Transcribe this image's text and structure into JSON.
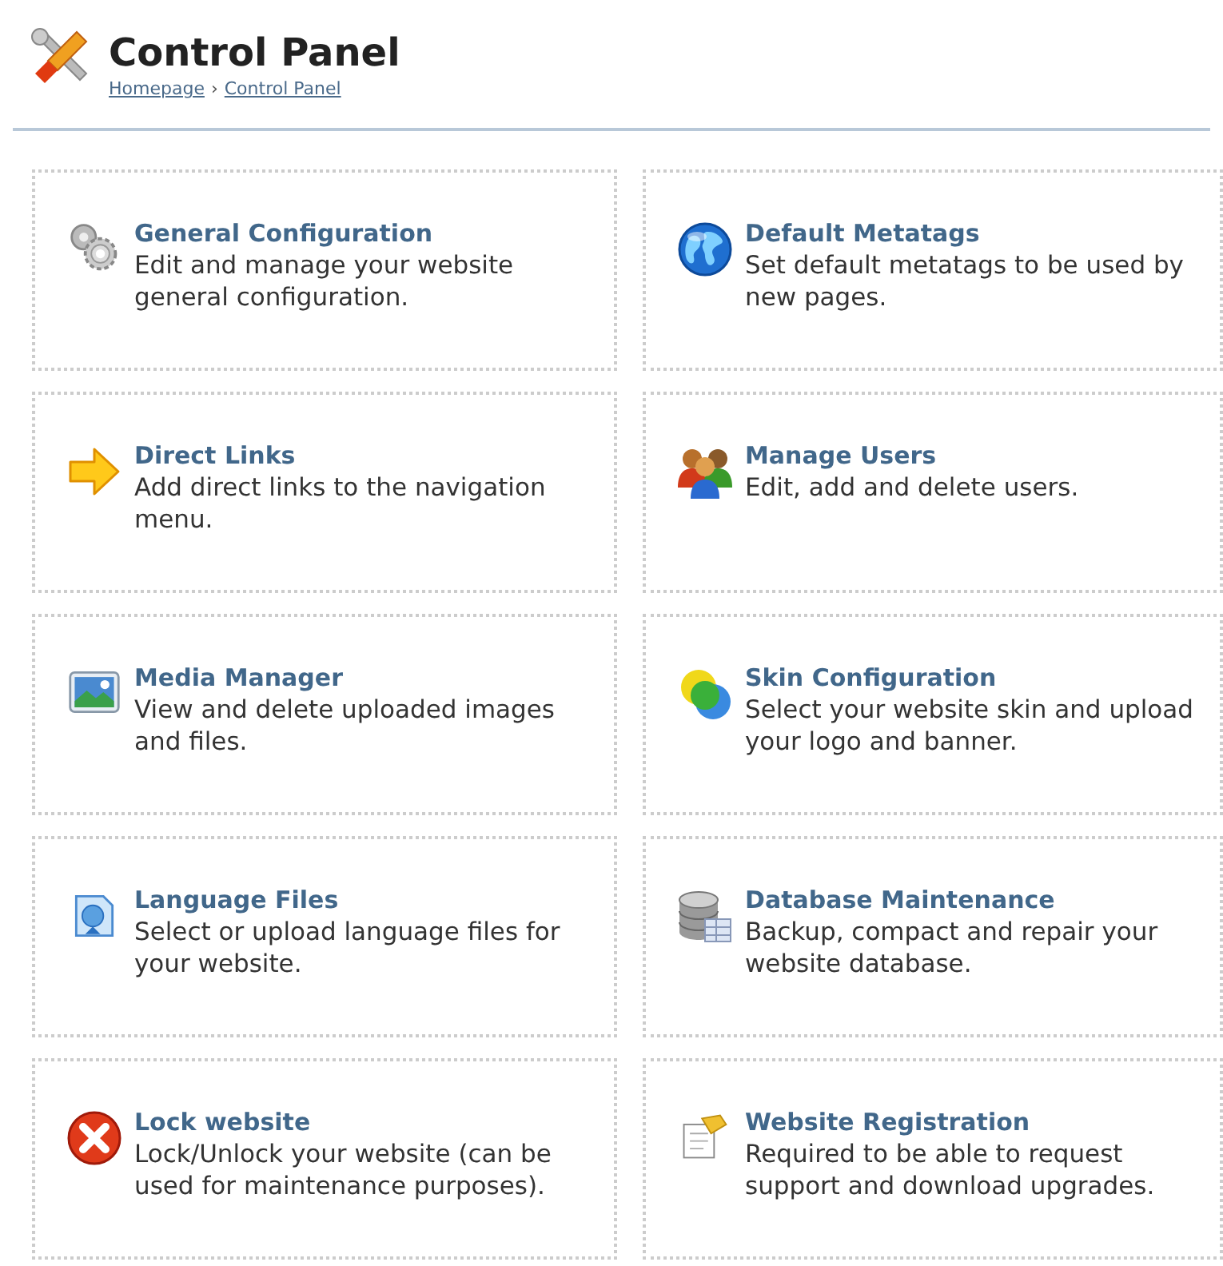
{
  "header": {
    "title": "Control Panel",
    "breadcrumb": [
      {
        "label": "Homepage"
      },
      {
        "label": "Control Panel"
      }
    ],
    "separator": "›"
  },
  "items": [
    {
      "title": "General Configuration",
      "description": "Edit and manage your website general configuration."
    },
    {
      "title": "Default Metatags",
      "description": "Set default metatags to be used by new pages."
    },
    {
      "title": "Direct Links",
      "description": "Add direct links to the navigation menu."
    },
    {
      "title": "Manage Users",
      "description": "Edit, add and delete users."
    },
    {
      "title": "Media Manager",
      "description": "View and delete uploaded images and files."
    },
    {
      "title": "Skin Configuration",
      "description": "Select your website skin and upload your logo and banner."
    },
    {
      "title": "Language Files",
      "description": "Select or upload language files for your website."
    },
    {
      "title": "Database Maintenance",
      "description": "Backup, compact and repair your website database."
    },
    {
      "title": "Lock website",
      "description": "Lock/Unlock your website (can be used for maintenance purposes)."
    },
    {
      "title": "Website Registration",
      "description": "Required to be able to request support and download upgrades."
    }
  ]
}
